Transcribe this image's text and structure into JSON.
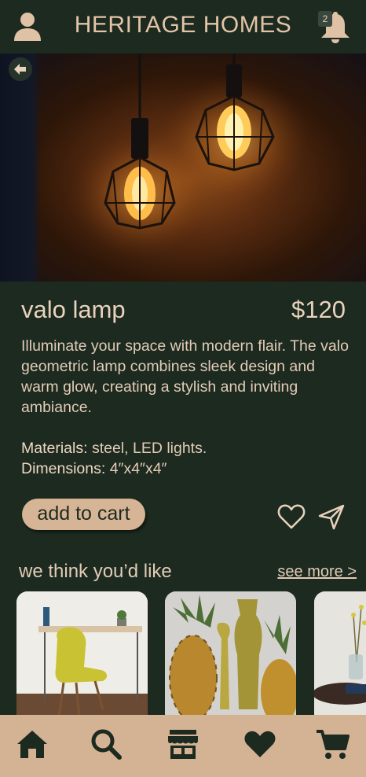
{
  "header": {
    "title": "HERITAGE HOMES",
    "notification_count": "2",
    "icons": {
      "avatar": "user-icon",
      "notifications": "bell-icon"
    }
  },
  "hero": {
    "back_icon": "arrow-left-icon"
  },
  "product": {
    "name": "valo lamp",
    "price": "$120",
    "description": "Illuminate your space with modern flair. The valo geometric lamp combines sleek design and warm glow, creating a stylish and inviting ambiance.",
    "materials_label": "Materials:",
    "materials_value": " steel, LED lights.",
    "dimensions_label": "Dimensions:",
    "dimensions_value": " 4″x4″x4″",
    "add_to_cart_label": "add to cart",
    "icons": {
      "favorite": "heart-outline-icon",
      "share": "send-icon"
    }
  },
  "recommendations": {
    "title": "we think you’d like",
    "see_more_label": "see more >",
    "items": [
      {
        "name": "yellow chair and desk"
      },
      {
        "name": "pineapples and amber vases"
      },
      {
        "name": "plant and books on table"
      }
    ]
  },
  "bottom_nav": {
    "items": [
      {
        "icon": "home-icon"
      },
      {
        "icon": "search-icon"
      },
      {
        "icon": "store-icon"
      },
      {
        "icon": "heart-icon"
      },
      {
        "icon": "cart-icon"
      }
    ]
  },
  "colors": {
    "background": "#1c2a20",
    "accent": "#d6b596",
    "text": "#e8d2bd"
  }
}
